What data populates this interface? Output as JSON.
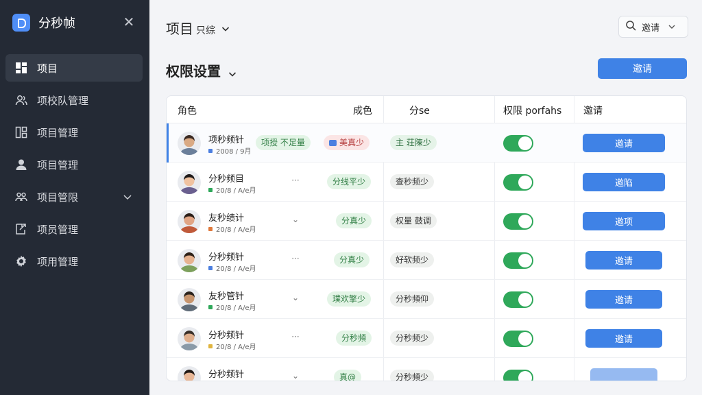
{
  "app": {
    "name": "分秒帧"
  },
  "sidebar": {
    "items": [
      {
        "label": "项目",
        "active": true,
        "icon": "dashboard-icon"
      },
      {
        "label": "项校队管理",
        "icon": "users-icon"
      },
      {
        "label": "项目管理",
        "icon": "apps-icon"
      },
      {
        "label": "项目管理",
        "icon": "user-icon"
      },
      {
        "label": "项目管限",
        "icon": "team-icon",
        "expandable": true
      },
      {
        "label": "项员管理",
        "icon": "export-icon"
      },
      {
        "label": "项用管理",
        "icon": "gear-icon"
      }
    ]
  },
  "header": {
    "title": "项目",
    "subtitle": "只综",
    "search_label": "邀请"
  },
  "section": {
    "title": "权限设置",
    "invite_button": "邀请"
  },
  "table": {
    "columns": [
      "角色",
      "成色",
      "分se",
      "权限 porfahs",
      "邀请"
    ],
    "rows": [
      {
        "name": "项秒频针",
        "meta": "2008 / 9月",
        "meta_color": "#4c7fe0",
        "tag": "项授 不足量",
        "action": "",
        "status": "美真少",
        "status_color": "red",
        "scope": "主 荘陳少",
        "scope_color": "green",
        "button": "邀请",
        "selected": true
      },
      {
        "name": "分秒频目",
        "meta": "20/8 / A/e月",
        "meta_color": "#2fa85a",
        "tag": "",
        "action": "···",
        "status": "分线平少",
        "status_color": "green",
        "scope": "查秒频少",
        "scope_color": "gray",
        "button": "邀陷"
      },
      {
        "name": "友秒绩计",
        "meta": "20/8 / A/e月",
        "meta_color": "#e07a3d",
        "tag": "",
        "action": "⌄",
        "status": "分真少",
        "status_color": "green",
        "scope": "权量 鼓调",
        "scope_color": "gray",
        "button": "邀项"
      },
      {
        "name": "分秒频针",
        "meta": "20/8 / A/e月",
        "meta_color": "#4c7fe0",
        "tag": "",
        "action": "···",
        "status": "分真少",
        "status_color": "green",
        "scope": "好软频少",
        "scope_color": "gray",
        "button": "邀请"
      },
      {
        "name": "友秒管针",
        "meta": "20/8 / A/e月",
        "meta_color": "#2fa85a",
        "tag": "",
        "action": "⌄",
        "status": "璞欢擎少",
        "status_color": "green",
        "scope": "分秒頻仰",
        "scope_color": "gray",
        "button": "邀请"
      },
      {
        "name": "分秒频针",
        "meta": "20/8 / A/e月",
        "meta_color": "#e0b43d",
        "tag": "",
        "action": "···",
        "status": "分秒頻",
        "status_color": "green",
        "scope": "分秒频少",
        "scope_color": "gray",
        "button": "邀请"
      },
      {
        "name": "分秒频针",
        "meta": "",
        "meta_color": "#4c7fe0",
        "tag": "",
        "action": "⌄",
        "status": "真@",
        "status_color": "green",
        "scope": "分秒頻少",
        "scope_color": "gray",
        "button": ""
      }
    ]
  },
  "colors": {
    "accent": "#3f82e6",
    "sidebar": "#242a35",
    "toggle_on": "#2fa85a"
  }
}
